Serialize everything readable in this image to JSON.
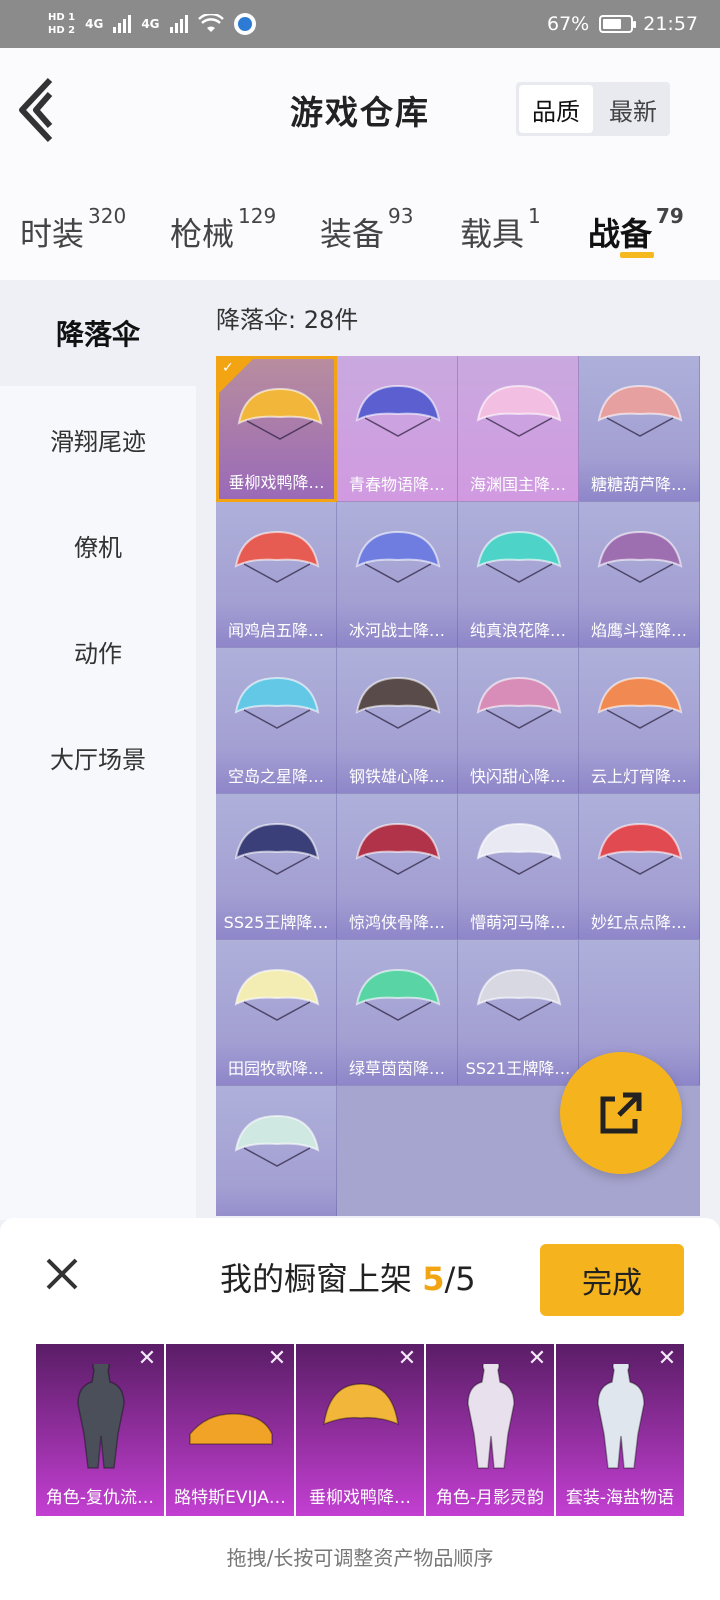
{
  "status_bar": {
    "hd1": "HD 1",
    "hd2": "HD 2",
    "net1": "4G",
    "net2": "4G",
    "battery": "67%",
    "time": "21:57",
    "battery_level": 0.67
  },
  "header": {
    "title": "游戏仓库",
    "sort": {
      "quality": "品质",
      "newest": "最新"
    }
  },
  "tabs": [
    {
      "label": "时装",
      "count": "320"
    },
    {
      "label": "枪械",
      "count": "129"
    },
    {
      "label": "装备",
      "count": "93"
    },
    {
      "label": "载具",
      "count": "1"
    },
    {
      "label": "战备",
      "count": "79"
    }
  ],
  "sidebar": {
    "items": [
      "降落伞",
      "滑翔尾迹",
      "僚机",
      "动作",
      "大厅场景"
    ]
  },
  "content": {
    "count_label": "降落伞: 28件",
    "items": [
      {
        "name": "垂柳戏鸭降…",
        "color": "#f2b63a"
      },
      {
        "name": "青春物语降…",
        "color": "#5b5fd0"
      },
      {
        "name": "海渊国主降…",
        "color": "#f2bfe2"
      },
      {
        "name": "糖糖葫芦降…",
        "color": "#e7a0a0"
      },
      {
        "name": "闻鸡启五降…",
        "color": "#e65b52"
      },
      {
        "name": "冰河战士降…",
        "color": "#6f7de0"
      },
      {
        "name": "纯真浪花降…",
        "color": "#4ed3c9"
      },
      {
        "name": "焰鹰斗篷降…",
        "color": "#9d6fb1"
      },
      {
        "name": "空岛之星降…",
        "color": "#63c7e6"
      },
      {
        "name": "钢铁雄心降…",
        "color": "#5a4b4b"
      },
      {
        "name": "快闪甜心降…",
        "color": "#d78db7"
      },
      {
        "name": "云上灯宵降…",
        "color": "#f08a52"
      },
      {
        "name": "SS25王牌降…",
        "color": "#3a3f7a"
      },
      {
        "name": "惊鸿侠骨降…",
        "color": "#b0334a"
      },
      {
        "name": "懵萌河马降…",
        "color": "#e9e9f4"
      },
      {
        "name": "妙红点点降…",
        "color": "#e24a52"
      },
      {
        "name": "田园牧歌降…",
        "color": "#f3edb4"
      },
      {
        "name": "绿草茵茵降…",
        "color": "#58d4a5"
      },
      {
        "name": "SS21王牌降…",
        "color": "#d8d8e3"
      },
      {
        "name": "",
        "color": ""
      },
      {
        "name": "",
        "color": "#cfe8e2"
      }
    ]
  },
  "sheet": {
    "title": "我的橱窗上架 ",
    "count": "5",
    "total": "/5",
    "done": "完成",
    "close_icon": "close-icon",
    "remove_symbol": "✕",
    "items": [
      {
        "name": "角色-复仇流…",
        "color": "#4a4f5a"
      },
      {
        "name": "路特斯EVIJA…",
        "color": "#f0a326"
      },
      {
        "name": "垂柳戏鸭降…",
        "color": "#f2b63a"
      },
      {
        "name": "角色-月影灵韵",
        "color": "#e8e0ec"
      },
      {
        "name": "套装-海盐物语",
        "color": "#dfe6ee"
      }
    ],
    "hint": "拖拽/长按可调整资产物品顺序"
  },
  "accent": "#f5b41d"
}
